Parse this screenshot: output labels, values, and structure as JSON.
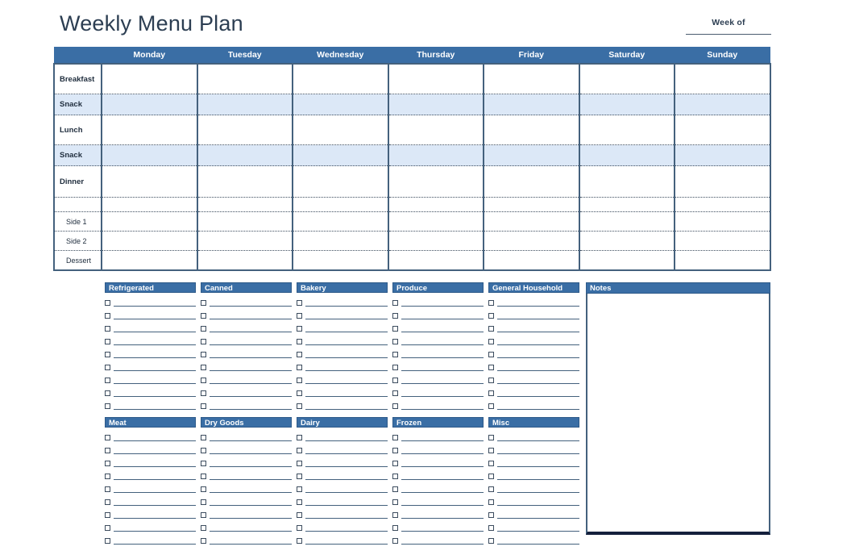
{
  "page": {
    "title": "Weekly Menu Plan",
    "accent_color": "#3A6EA5",
    "grid_border_color": "#44617D",
    "shade_color": "#DCE8F7",
    "background_color": "#FFFFFF"
  },
  "week_of": {
    "label": "Week of",
    "value": ""
  },
  "calendar": {
    "corner_label": "",
    "days": [
      "Monday",
      "Tuesday",
      "Wednesday",
      "Thursday",
      "Friday",
      "Saturday",
      "Sunday"
    ],
    "rows": [
      {
        "label": "Breakfast",
        "shaded": false,
        "sub": false
      },
      {
        "label": "Snack",
        "shaded": true,
        "sub": false
      },
      {
        "label": "Lunch",
        "shaded": false,
        "sub": false
      },
      {
        "label": "Snack",
        "shaded": true,
        "sub": false
      },
      {
        "label": "Dinner",
        "shaded": false,
        "sub": false
      },
      {
        "label": "",
        "shaded": false,
        "sub": false
      },
      {
        "label": "Side 1",
        "shaded": false,
        "sub": true
      },
      {
        "label": "Side 2",
        "shaded": false,
        "sub": true
      },
      {
        "label": "Dessert",
        "shaded": false,
        "sub": true
      }
    ]
  },
  "shopping_list": {
    "rows_per_category": 9,
    "group_top": [
      {
        "title": "Refrigerated"
      },
      {
        "title": "Canned"
      },
      {
        "title": "Bakery"
      },
      {
        "title": "Produce"
      },
      {
        "title": "General Household"
      }
    ],
    "group_bottom": [
      {
        "title": "Meat"
      },
      {
        "title": "Dry Goods"
      },
      {
        "title": "Dairy"
      },
      {
        "title": "Frozen"
      },
      {
        "title": "Misc"
      }
    ]
  },
  "notes": {
    "title": "Notes",
    "value": ""
  }
}
